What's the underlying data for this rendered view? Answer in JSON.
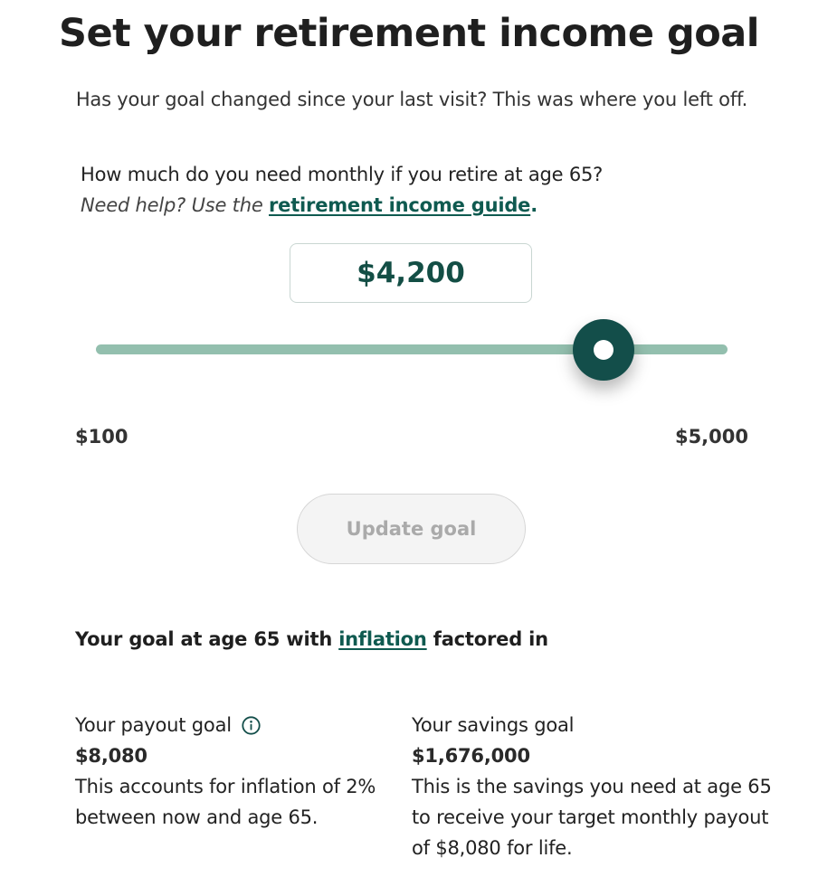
{
  "header": {
    "title": "Set your retirement income goal",
    "subtitle": "Has your goal changed since your last visit? This was where you left off."
  },
  "question": {
    "text": "How much do you need monthly if you retire at age 65?",
    "help_prefix": "Need help? Use the ",
    "help_link": "retirement income guide",
    "help_suffix": "."
  },
  "slider": {
    "current_value": "$4,200",
    "min_label": "$100",
    "max_label": "$5,000",
    "min": 100,
    "max": 5000,
    "value": 4200
  },
  "update_button": {
    "label": "Update goal"
  },
  "goal_section": {
    "heading_prefix": "Your goal at age 65 with ",
    "heading_link": "inflation",
    "heading_suffix": " factored in"
  },
  "payout": {
    "label": "Your payout goal",
    "value": "$8,080",
    "description": "This accounts for inflation of 2% between now and age 65."
  },
  "savings": {
    "label": "Your savings goal",
    "value": "$1,676,000",
    "description": "This is the savings you need at age 65 to receive your target monthly payout of $8,080 for life."
  },
  "colors": {
    "accent": "#134e4a",
    "track": "#93bfae",
    "link": "#0f5a50"
  },
  "icons": {
    "info": "info-circle-icon"
  }
}
